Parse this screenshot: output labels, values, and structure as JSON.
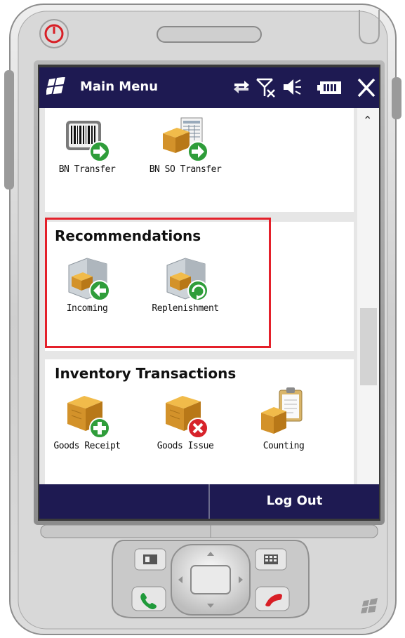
{
  "titlebar": {
    "title": "Main Menu"
  },
  "sections": {
    "bn": {
      "items": [
        {
          "label": "BN Transfer",
          "icon": "barcode-transfer-icon"
        },
        {
          "label": "BN SO Transfer",
          "icon": "document-transfer-icon"
        }
      ]
    },
    "recommendations": {
      "title": "Recommendations",
      "items": [
        {
          "label": "Incoming",
          "icon": "box-incoming-icon"
        },
        {
          "label": "Replenishment",
          "icon": "box-replenish-icon"
        }
      ]
    },
    "inventory": {
      "title": "Inventory Transactions",
      "items": [
        {
          "label": "Goods Receipt",
          "icon": "box-add-icon"
        },
        {
          "label": "Goods Issue",
          "icon": "box-remove-icon"
        },
        {
          "label": "Counting",
          "icon": "clipboard-box-icon"
        }
      ]
    }
  },
  "softkeys": {
    "right": "Log Out"
  },
  "colors": {
    "titlebar_bg": "#1e1a52",
    "highlight": "#e4202a"
  }
}
